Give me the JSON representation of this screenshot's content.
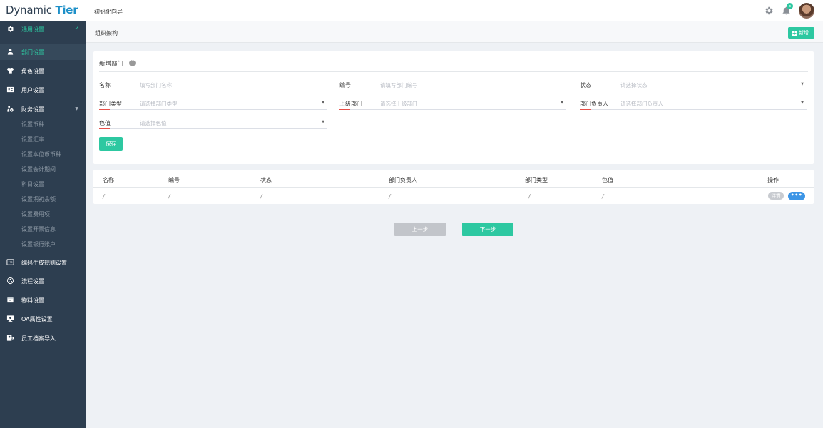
{
  "app": {
    "logo_main": "Dynamic ",
    "logo_accent": "Tier",
    "page_title": "初始化向导",
    "notification_count": "5"
  },
  "sidebar": {
    "items": [
      {
        "label": "通用设置",
        "icon": "gear-icon",
        "state": "expanded-checked"
      },
      {
        "label": "部门设置",
        "icon": "org-icon",
        "state": "active"
      },
      {
        "label": "角色设置",
        "icon": "shirt-icon"
      },
      {
        "label": "用户设置",
        "icon": "id-card-icon"
      },
      {
        "label": "财务设置",
        "icon": "finance-icon",
        "state": "expandable"
      },
      {
        "label": "编码生成规则设置",
        "icon": "code-icon"
      },
      {
        "label": "流程设置",
        "icon": "flow-icon"
      },
      {
        "label": "物料设置",
        "icon": "box-icon"
      },
      {
        "label": "OA属性设置",
        "icon": "monitor-icon"
      },
      {
        "label": "员工档案导入",
        "icon": "import-icon"
      }
    ],
    "finance_sub": [
      "设置币种",
      "设置汇率",
      "设置本位币币种",
      "设置会计期间",
      "科目设置",
      "设置期初余额",
      "设置费用项",
      "设置开票信息",
      "设置银行账户"
    ]
  },
  "header": {
    "breadcrumb": "组织架构",
    "add_label": "新增"
  },
  "form": {
    "title": "新增部门",
    "fields": [
      {
        "label": "名称",
        "placeholder": "填写部门名称"
      },
      {
        "label": "编号",
        "placeholder": "请填写部门编号"
      },
      {
        "label": "状态",
        "placeholder": "请选择状态"
      },
      {
        "label": "部门类型",
        "placeholder": "请选择部门类型"
      },
      {
        "label": "上级部门",
        "placeholder": "请选择上级部门"
      },
      {
        "label": "部门负责人",
        "placeholder": "请选择部门负责人"
      },
      {
        "label": "色值",
        "placeholder": "请选择色值"
      }
    ],
    "save_label": "保存"
  },
  "table": {
    "headers": [
      "名称",
      "编号",
      "状态",
      "部门负责人",
      "部门类型",
      "色值",
      "操作"
    ],
    "rows": [
      {
        "cells": [
          "/",
          "/",
          "/",
          "/",
          "/",
          "/"
        ],
        "detail_label": "详情",
        "more_label": "•••"
      }
    ]
  },
  "steps": {
    "prev_label": "上一步",
    "next_label": "下一步"
  },
  "colors": {
    "accent": "#2dc8a1",
    "sidebar_bg": "#2d3e50",
    "logo_accent": "#1e90c8",
    "more_button": "#3c95e6"
  }
}
